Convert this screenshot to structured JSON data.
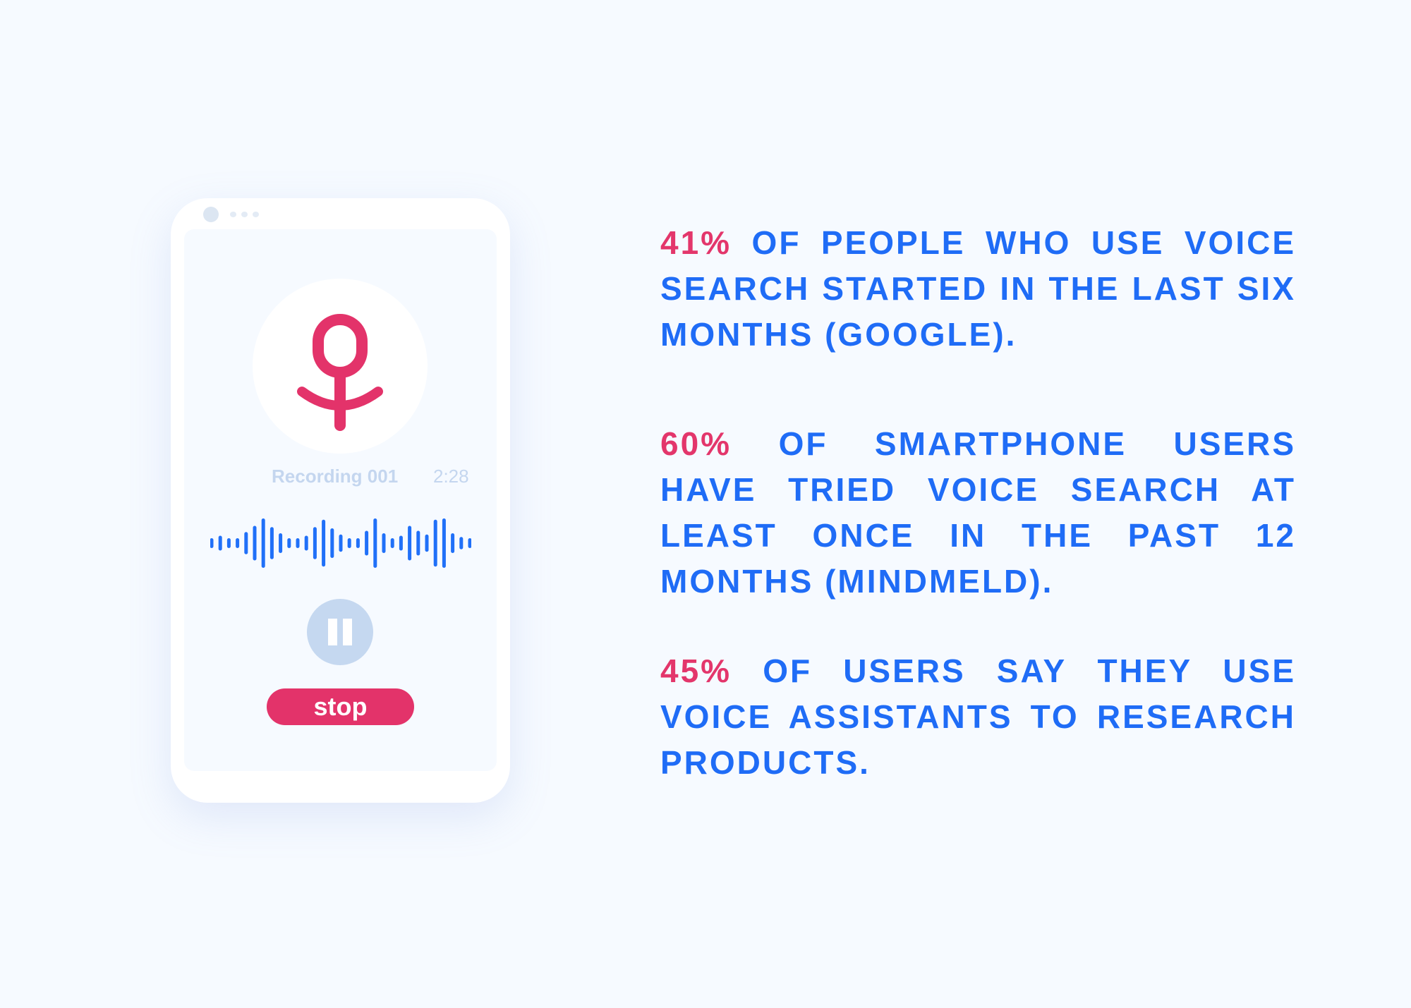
{
  "phone": {
    "recording_name": "Recording 001",
    "recording_time": "2:28",
    "stop_label": "stop",
    "icons": {
      "mic": "microphone-icon",
      "pause": "pause-icon"
    }
  },
  "colors": {
    "accent": "#e3366b",
    "text": "#1f6cf6",
    "wave": "#2070f8",
    "background": "#f6faff"
  },
  "stats": [
    {
      "percent": "41%",
      "lines": [
        "OF PEOPLE WHO USE VOICE",
        "SEARCH STARTED IN THE LAST SIX",
        "MONTHS (GOOGLE)."
      ]
    },
    {
      "percent": "60%",
      "lines": [
        "OF SMARTPHONE USERS",
        "HAVE TRIED VOICE SEARCH AT",
        "LEAST ONCE IN THE PAST 12",
        "MONTHS (MINDMELD)."
      ]
    },
    {
      "percent": "45%",
      "lines": [
        "OF USERS SAY THEY USE",
        "VOICE ASSISTANTS TO RESEARCH",
        "PRODUCTS."
      ]
    }
  ]
}
